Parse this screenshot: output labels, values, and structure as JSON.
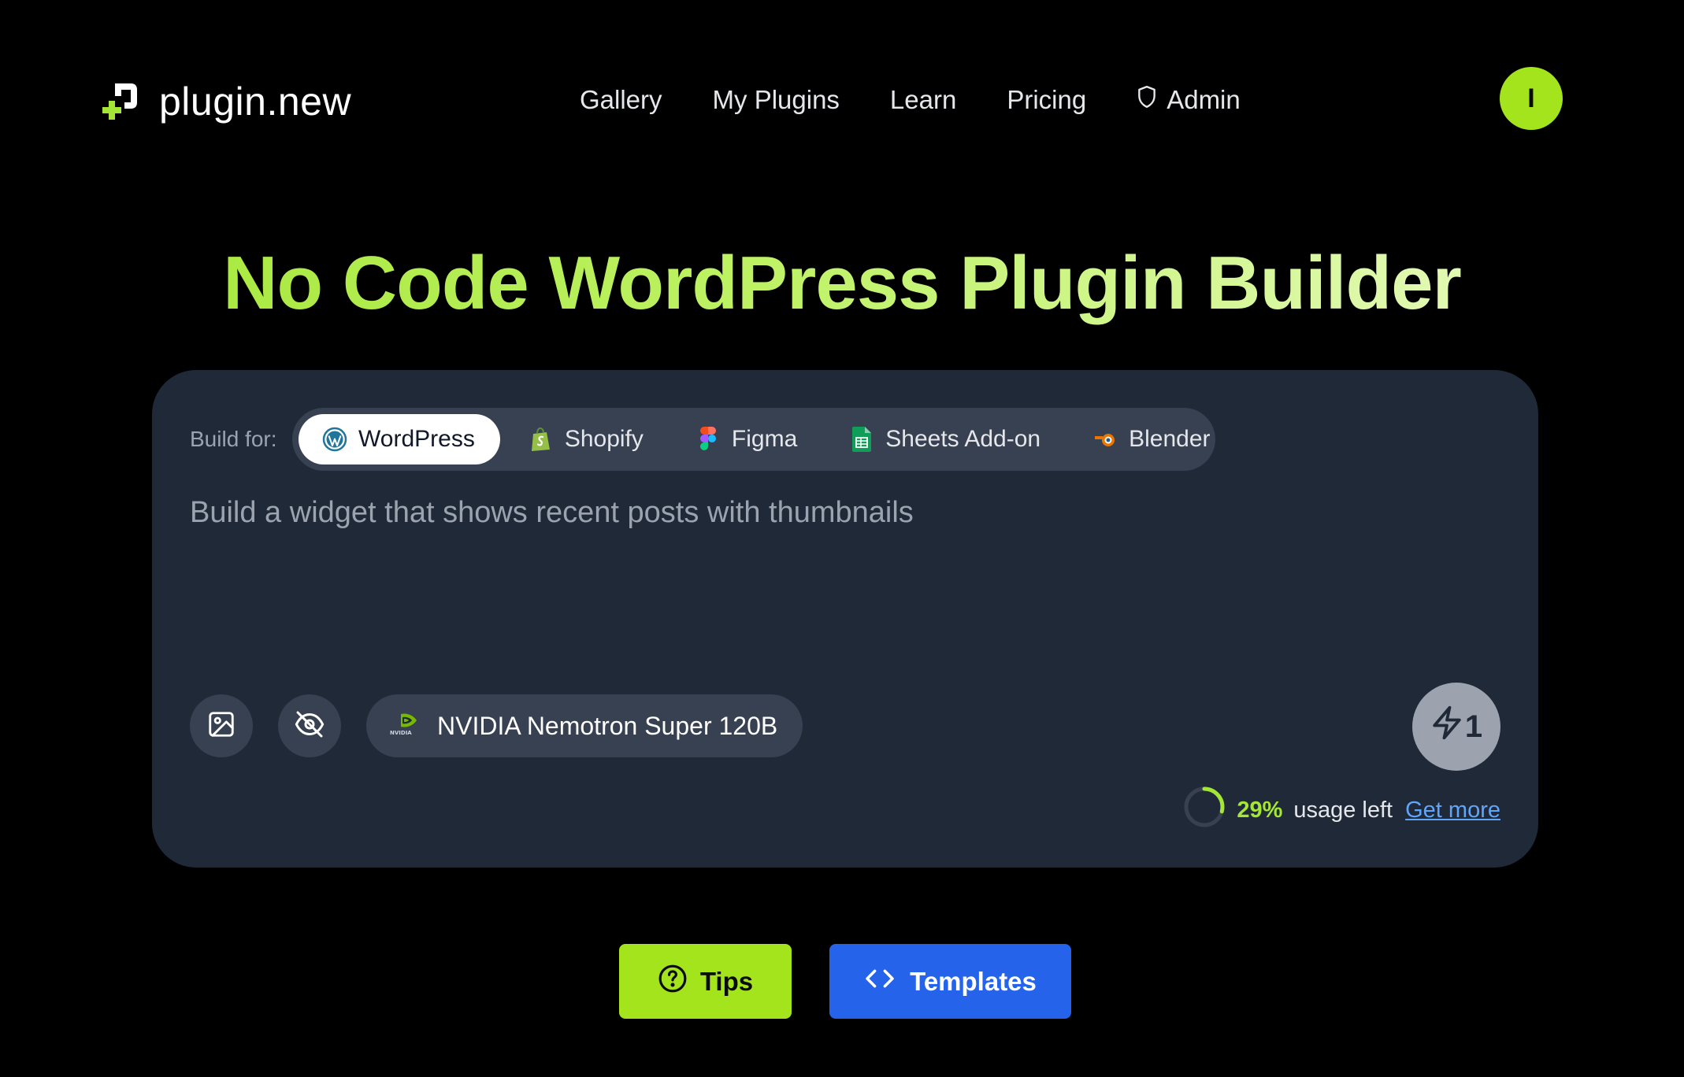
{
  "header": {
    "logo_text": "plugin.new",
    "nav": [
      {
        "label": "Gallery"
      },
      {
        "label": "My Plugins"
      },
      {
        "label": "Learn"
      },
      {
        "label": "Pricing"
      },
      {
        "label": "Admin",
        "icon": "shield-icon"
      }
    ],
    "avatar_initial": "I"
  },
  "headline": "No Code WordPress Plugin Builder",
  "builder": {
    "build_for_label": "Build for:",
    "platforms": [
      {
        "label": "WordPress",
        "icon": "wordpress-icon",
        "active": true
      },
      {
        "label": "Shopify",
        "icon": "shopify-icon",
        "active": false
      },
      {
        "label": "Figma",
        "icon": "figma-icon",
        "active": false
      },
      {
        "label": "Sheets Add-on",
        "icon": "sheets-icon",
        "active": false
      },
      {
        "label": "Blender",
        "icon": "blender-icon",
        "active": false
      }
    ],
    "prompt_placeholder": "Build a widget that shows recent posts with thumbnails",
    "model_label": "NVIDIA Nemotron Super 120B",
    "model_icon": "nvidia-icon",
    "submit_count": "1",
    "usage": {
      "percent_label": "29%",
      "percent_value": 29,
      "text": "usage left",
      "link": "Get more"
    }
  },
  "actions": {
    "tips_label": "Tips",
    "templates_label": "Templates"
  },
  "colors": {
    "background": "#000000",
    "card": "#1f2937",
    "accent_lime": "#a3e41c",
    "accent_blue": "#2563eb",
    "link_blue": "#60a5fa"
  }
}
